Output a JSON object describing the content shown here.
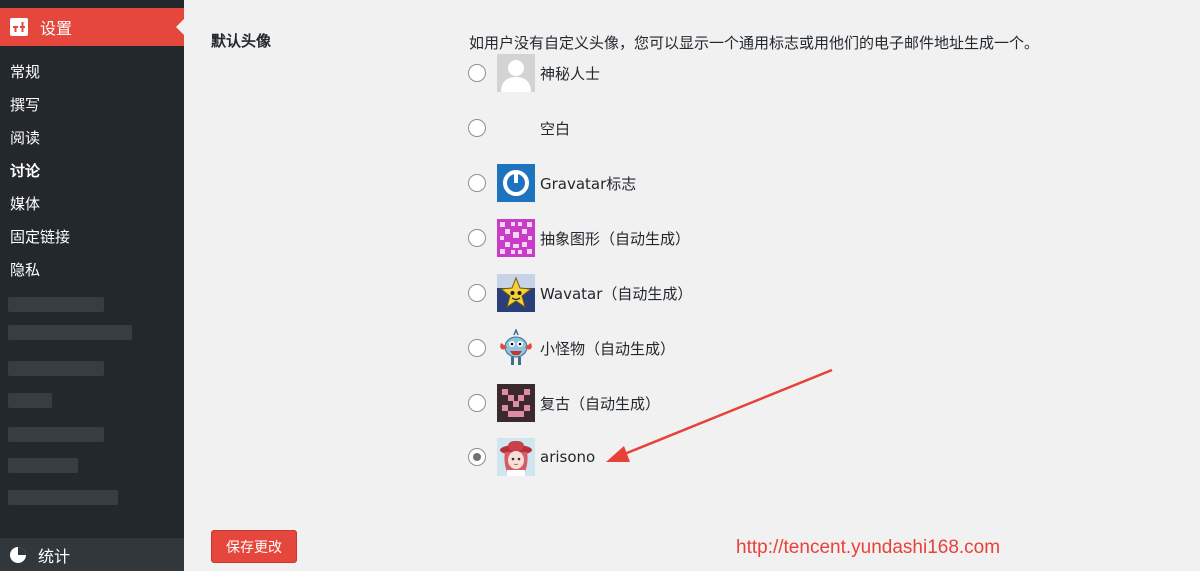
{
  "sidebar": {
    "header_label": "设置",
    "items": [
      {
        "label": "常规"
      },
      {
        "label": "撰写"
      },
      {
        "label": "阅读"
      },
      {
        "label": "讨论",
        "current": true
      },
      {
        "label": "媒体"
      },
      {
        "label": "固定链接"
      },
      {
        "label": "隐私"
      }
    ],
    "stats_label": "统计"
  },
  "settings": {
    "field_label": "默认头像",
    "description": "如用户没有自定义头像，您可以显示一个通用标志或用他们的电子邮件地址生成一个。",
    "options": [
      {
        "label": "神秘人士",
        "avatar": "mystery-person",
        "checked": false
      },
      {
        "label": "空白",
        "avatar": "blank",
        "checked": false
      },
      {
        "label": "Gravatar标志",
        "avatar": "gravatar-logo",
        "checked": false
      },
      {
        "label": "抽象图形（自动生成）",
        "avatar": "identicon",
        "checked": false
      },
      {
        "label": "Wavatar（自动生成）",
        "avatar": "wavatar",
        "checked": false
      },
      {
        "label": "小怪物（自动生成）",
        "avatar": "monsterid",
        "checked": false
      },
      {
        "label": "复古（自动生成）",
        "avatar": "retro",
        "checked": false
      },
      {
        "label": "arisono",
        "avatar": "custom-anime-avatar",
        "checked": true
      }
    ],
    "save_label": "保存更改"
  },
  "watermark": "http://tencent.yundashi168.com",
  "colors": {
    "accent": "#e5473d",
    "sidebar_bg": "#23282d",
    "page_bg": "#f1f1f1",
    "annotation_arrow": "#e8413a"
  }
}
